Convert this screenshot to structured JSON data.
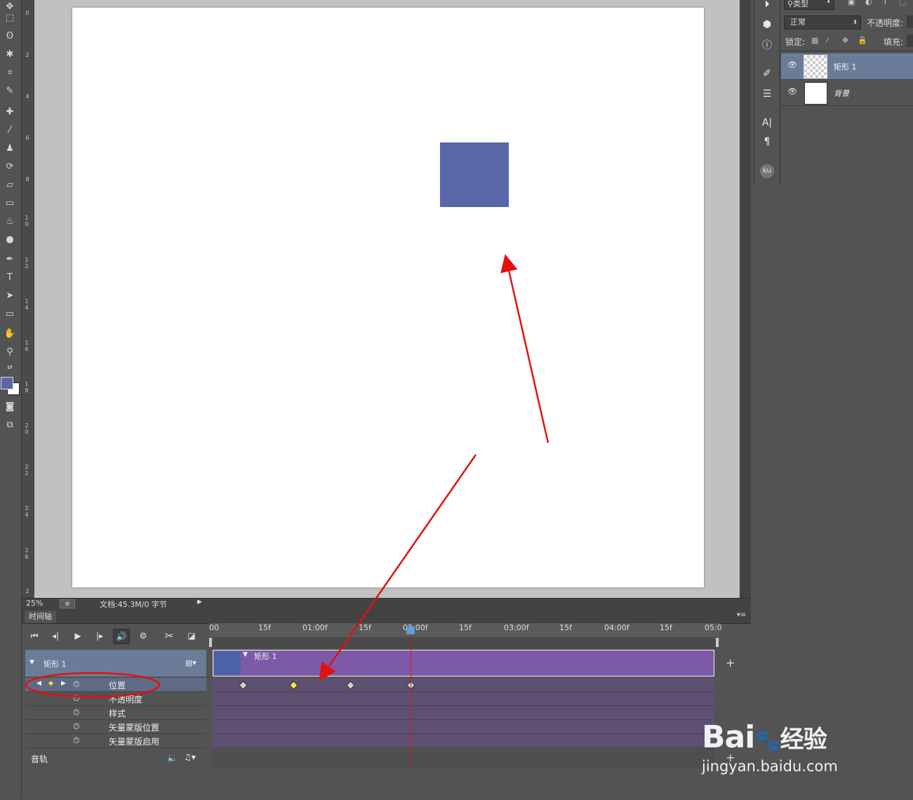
{
  "status": {
    "zoom": "25%",
    "doc_info": "文档:45.3M/0 字节"
  },
  "timeline": {
    "tab": "时间轴",
    "ticks": [
      "00",
      "15f",
      "01:00f",
      "15f",
      "02:00f",
      "15f",
      "03:00f",
      "15f",
      "04:00f",
      "15f",
      "05:0"
    ],
    "layer_name": "矩形 1",
    "clip_label": "矩形 1",
    "properties": [
      "位置",
      "不透明度",
      "样式",
      "矢量蒙版位置",
      "矢量蒙版启用"
    ],
    "audio_label": "音轨"
  },
  "layers_panel": {
    "filter_label": "类型",
    "blend_mode": "正常",
    "opacity_label": "不透明度:",
    "lock_label": "锁定:",
    "fill_label": "填充:",
    "layers": [
      {
        "name": "矩形 1",
        "selected": true
      },
      {
        "name": "背景",
        "selected": false
      }
    ]
  },
  "ruler_numbers": [
    "0",
    "2",
    "4",
    "6",
    "8",
    "10",
    "12",
    "14",
    "16",
    "18",
    "20",
    "22",
    "24",
    "26",
    "2"
  ],
  "colors": {
    "rect": "#5867a8",
    "clip": "#7c5aa8",
    "selection": "#6a7c98",
    "annotation": "#e01212"
  },
  "watermark": {
    "brand": "Bai",
    "brand_suffix": "经验",
    "url": "jingyan.baidu.com"
  }
}
